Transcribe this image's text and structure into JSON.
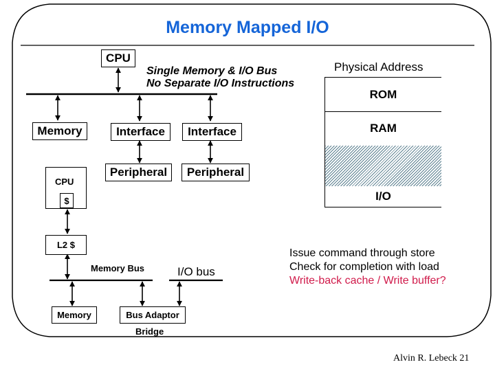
{
  "slide": {
    "title": "Memory Mapped I/O",
    "footer": "Alvin R. Lebeck 21",
    "title_color": "#1565d8",
    "highlight_color": "#d01a4a"
  },
  "top_diagram": {
    "cpu_label": "CPU",
    "annotation_line1": "Single Memory & I/O Bus",
    "annotation_line2": "No Separate I/O Instructions",
    "memory_label": "Memory",
    "interface1_label": "Interface",
    "interface2_label": "Interface",
    "peripheral1_label": "Peripheral",
    "peripheral2_label": "Peripheral"
  },
  "address_map": {
    "heading": "Physical Address",
    "regions": [
      {
        "label": "ROM",
        "pattern": "plain"
      },
      {
        "label": "RAM",
        "pattern": "plain"
      },
      {
        "label": "",
        "pattern": "hatched"
      },
      {
        "label": "I/O",
        "pattern": "plain"
      }
    ]
  },
  "bottom_diagram": {
    "cpu_label": "CPU",
    "l1_cache_label": "$",
    "l2_cache_label": "L2 $",
    "memory_bus_label": "Memory Bus",
    "io_bus_label": "I/O bus",
    "memory_label": "Memory",
    "bus_adaptor_label": "Bus Adaptor",
    "bridge_label": "Bridge"
  },
  "notes": {
    "line1": "Issue command through store",
    "line2": "Check for completion with load",
    "line3": "Write-back cache / Write buffer?"
  }
}
